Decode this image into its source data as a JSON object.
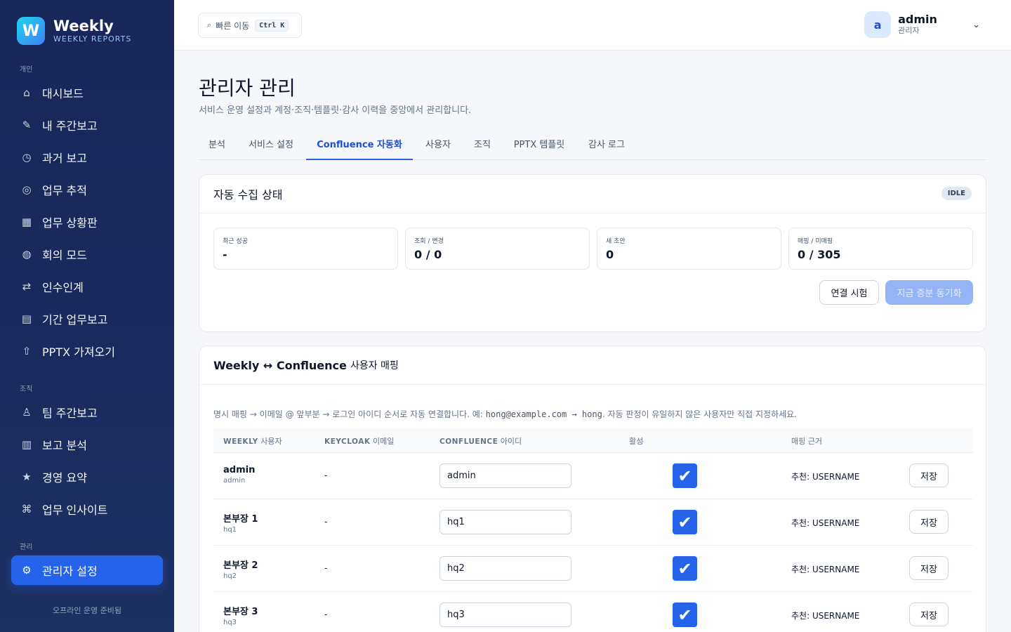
{
  "brand": {
    "logo_letter": "W",
    "name": "Weekly",
    "subtitle": "WEEKLY REPORTS"
  },
  "sidebar": {
    "sections": [
      "개인",
      "조직",
      "관리"
    ],
    "items": [
      {
        "label": "대시보드",
        "icon": "home-icon"
      },
      {
        "label": "내 주간보고",
        "icon": "pencil-icon"
      },
      {
        "label": "과거 보고",
        "icon": "clock-icon"
      },
      {
        "label": "업무 추적",
        "icon": "target-icon"
      },
      {
        "label": "업무 상황판",
        "icon": "grid-icon"
      },
      {
        "label": "회의 모드",
        "icon": "globe-icon"
      },
      {
        "label": "인수인계",
        "icon": "swap-icon"
      },
      {
        "label": "기간 업무보고",
        "icon": "list-icon"
      },
      {
        "label": "PPTX 가져오기",
        "icon": "upload-icon"
      },
      {
        "label": "팀 주간보고",
        "icon": "team-icon"
      },
      {
        "label": "보고 분석",
        "icon": "barcode-icon"
      },
      {
        "label": "경영 요약",
        "icon": "star-icon"
      },
      {
        "label": "업무 인사이트",
        "icon": "command-icon"
      },
      {
        "label": "관리자 설정",
        "icon": "gear-icon"
      }
    ],
    "footer": "오프라인 운영 준비됨"
  },
  "header": {
    "quick_nav_label": "빠른 이동",
    "quick_nav_shortcut": "Ctrl K",
    "user_initial": "a",
    "user_name": "admin",
    "user_role": "관리자"
  },
  "page": {
    "title": "관리자 관리",
    "description": "서비스 운영 설정과 계정·조직·템플릿·감사 이력을 중앙에서 관리합니다."
  },
  "tabs": [
    "분석",
    "서비스 설정",
    "Confluence 자동화",
    "사용자",
    "조직",
    "PPTX 템플릿",
    "감사 로그"
  ],
  "active_tab": "Confluence 자동화",
  "status_card": {
    "title": "자동 수집 상태",
    "badge": "IDLE",
    "stats": [
      {
        "label": "최근 성공",
        "value": "-"
      },
      {
        "label": "조회 / 변경",
        "value": "0 / 0"
      },
      {
        "label": "새 초안",
        "value": "0"
      },
      {
        "label": "매핑 / 미매핑",
        "value": "0 / 305"
      }
    ],
    "test_button": "연결 시험",
    "sync_button": "지금 증분 동기화"
  },
  "mapping_card": {
    "title_bold": "Weekly ↔ Confluence",
    "title_rest": "사용자 매핑",
    "hint_prefix": "명시 매핑 → 이메일 @ 앞부분 → 로그인 아이디 순서로 자동 연결합니다. 예: ",
    "hint_example": "hong@example.com → hong",
    "hint_suffix": ". 자동 판정이 유일하지 않은 사용자만 직접 지정하세요.",
    "columns": [
      {
        "bold": "WEEKLY",
        "rest": "사용자"
      },
      {
        "bold": "KEYCLOAK",
        "rest": "이메일"
      },
      {
        "bold": "CONFLUENCE",
        "rest": "아이디"
      },
      {
        "bold": "",
        "rest": "활성"
      },
      {
        "bold": "",
        "rest": "매핑 근거"
      }
    ],
    "rows": [
      {
        "name": "admin",
        "login": "admin",
        "email": "-",
        "confluence_id": "admin",
        "active": true,
        "basis": "추천: USERNAME",
        "save": "저장"
      },
      {
        "name": "본부장 1",
        "login": "hq1",
        "email": "-",
        "confluence_id": "hq1",
        "active": true,
        "basis": "추천: USERNAME",
        "save": "저장"
      },
      {
        "name": "본부장 2",
        "login": "hq2",
        "email": "-",
        "confluence_id": "hq2",
        "active": true,
        "basis": "추천: USERNAME",
        "save": "저장"
      },
      {
        "name": "본부장 3",
        "login": "hq3",
        "email": "-",
        "confluence_id": "hq3",
        "active": true,
        "basis": "추천: USERNAME",
        "save": "저장"
      }
    ]
  },
  "colors": {
    "accent": "#2563eb",
    "sidebar_bg": "#1b2a5e",
    "primary_disabled": "#93b4f5"
  }
}
